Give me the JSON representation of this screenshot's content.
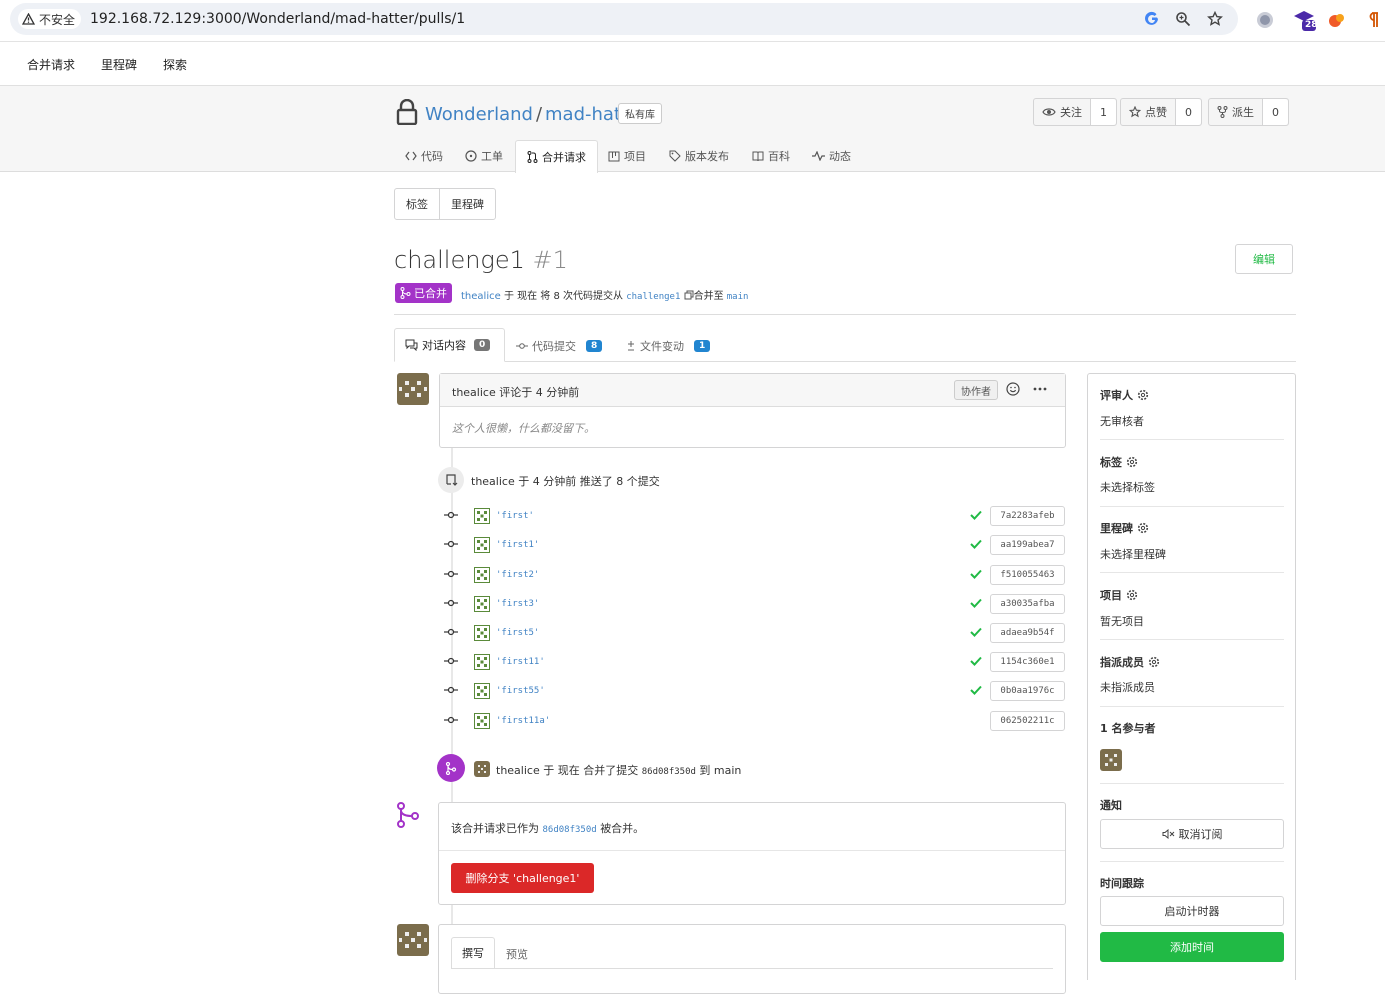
{
  "browser": {
    "insecure_label": "不安全",
    "url": "192.168.72.129:3000/Wonderland/mad-hatter/pulls/1",
    "extension_badge": "28"
  },
  "topnav": {
    "items": [
      "合并请求",
      "里程碑",
      "探索"
    ]
  },
  "repo": {
    "owner": "Wonderland",
    "separator": "/",
    "name": "mad-hatter",
    "private_label": "私有库",
    "watch": {
      "label": "关注",
      "count": "1"
    },
    "star": {
      "label": "点赞",
      "count": "0"
    },
    "fork": {
      "label": "派生",
      "count": "0"
    },
    "tabs": [
      "代码",
      "工单",
      "合并请求",
      "项目",
      "版本发布",
      "百科",
      "动态"
    ]
  },
  "labels_milestones": {
    "labels": "标签",
    "milestones": "里程碑"
  },
  "pr": {
    "title": "challenge1",
    "number": "#1",
    "edit_label": "编辑",
    "status": "已合并",
    "author": "thealice",
    "meta_middle": "于 现在 将 8 次代码提交从",
    "head_branch": "challenge1",
    "merge_into": "合并至",
    "base_branch": "main"
  },
  "pr_tabs": {
    "conversation": {
      "label": "对话内容",
      "count": "0"
    },
    "commits": {
      "label": "代码提交",
      "count": "8"
    },
    "files": {
      "label": "文件变动",
      "count": "1"
    }
  },
  "first_comment": {
    "header": "thealice 评论于 4 分钟前",
    "role": "协作者",
    "body": "这个人很懒，什么都没留下。"
  },
  "push_event": {
    "author": "thealice",
    "text": "于 4 分钟前 推送了 8 个提交"
  },
  "commits": [
    {
      "message": "'first'",
      "sha": "7a2283afeb",
      "verified": true
    },
    {
      "message": "'first1'",
      "sha": "aa199abea7",
      "verified": true
    },
    {
      "message": "'first2'",
      "sha": "f510055463",
      "verified": true
    },
    {
      "message": "'first3'",
      "sha": "a30035afba",
      "verified": true
    },
    {
      "message": "'first5'",
      "sha": "adaea9b54f",
      "verified": true
    },
    {
      "message": "'first11'",
      "sha": "1154c360e1",
      "verified": true
    },
    {
      "message": "'first55'",
      "sha": "0b0aa1976c",
      "verified": true
    },
    {
      "message": "'first11a'",
      "sha": "062502211c",
      "verified": false
    }
  ],
  "merge_event": {
    "author": "thealice",
    "text_before": "于 现在 合并了提交",
    "commit": "86d08f350d",
    "text_after": "到 main"
  },
  "merge_box": {
    "text_before": "该合并请求已作为",
    "commit": "86d08f350d",
    "text_after": "被合并。",
    "delete_button": "删除分支 'challenge1'"
  },
  "editor": {
    "write_tab": "撰写",
    "preview_tab": "预览"
  },
  "sidebar": {
    "reviewers": {
      "title": "评审人",
      "value": "无审核者"
    },
    "labels": {
      "title": "标签",
      "value": "未选择标签"
    },
    "milestone": {
      "title": "里程碑",
      "value": "未选择里程碑"
    },
    "projects": {
      "title": "项目",
      "value": "暂无项目"
    },
    "assignees": {
      "title": "指派成员",
      "value": "未指派成员"
    },
    "participants": {
      "title": "1 名参与者"
    },
    "notifications": {
      "title": "通知",
      "button": "取消订阅"
    },
    "time_tracking": {
      "title": "时间跟踪",
      "start_timer": "启动计时器",
      "add_time": "添加时间"
    }
  },
  "colors": {
    "merged_purple": "#a333c8",
    "link_blue": "#4183c4",
    "green": "#21ba45",
    "danger_red": "#db2828",
    "badge_grey": "#767676",
    "badge_blue": "#2185d0"
  }
}
